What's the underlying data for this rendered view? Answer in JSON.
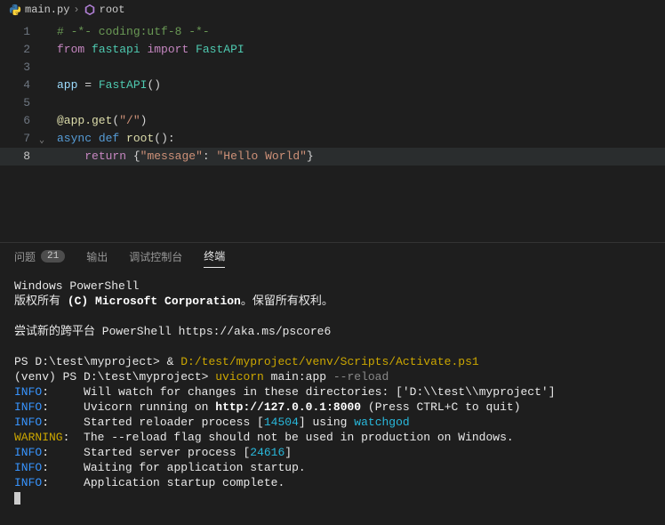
{
  "breadcrumb": {
    "file": "main.py",
    "symbol": "root"
  },
  "editor": {
    "lines": [
      {
        "n": 1,
        "html": "<span class='c-comment'># -*- coding:utf-8 -*-</span>"
      },
      {
        "n": 2,
        "html": "<span class='c-keyword'>from</span> <span class='c-module'>fastapi</span> <span class='c-keyword'>import</span> <span class='c-class'>FastAPI</span>"
      },
      {
        "n": 3,
        "html": ""
      },
      {
        "n": 4,
        "html": "<span class='c-var'>app</span> <span class='c-punc'>=</span> <span class='c-class'>FastAPI</span><span class='c-punc'>()</span>"
      },
      {
        "n": 5,
        "html": ""
      },
      {
        "n": 6,
        "html": "<span class='c-decor'>@app.get</span><span class='c-punc'>(</span><span class='c-str'>\"/\"</span><span class='c-punc'>)</span>"
      },
      {
        "n": 7,
        "html": "<span class='c-keyword2'>async</span> <span class='c-keyword2'>def</span> <span class='c-func'>root</span><span class='c-punc'>():</span>",
        "fold": true
      },
      {
        "n": 8,
        "html": "    <span class='c-keyword'>return</span> <span class='c-punc'>{</span><span class='c-str'>\"message\"</span><span class='c-punc'>:</span> <span class='c-str'>\"Hello World\"</span><span class='c-punc'>}</span>",
        "current": true,
        "hl": true
      }
    ]
  },
  "panel": {
    "tabs": {
      "problems": "问题",
      "problems_count": "21",
      "output": "输出",
      "debug": "调试控制台",
      "terminal": "终端"
    }
  },
  "terminal": {
    "l01": "Windows PowerShell",
    "l02a": "版权所有 ",
    "l02b": "(C) Microsoft Corporation",
    "l02c": "。保留所有权利。",
    "l04a": "尝试新的跨平台 PowerShell https://aka.ms/pscore6",
    "l06a": "PS D:\\test\\myproject> & ",
    "l06b": "D:/test/myproject/venv/Scripts/Activate.ps1",
    "l07a": "(venv) PS D:\\test\\myproject> ",
    "l07b": "uvicorn",
    "l07c": " main:app ",
    "l07d": "--reload",
    "l08a": "INFO",
    "l08b": ":     Will watch for changes in these directories: ['D:\\\\test\\\\myproject']",
    "l09a": "INFO",
    "l09b": ":     Uvicorn running on ",
    "l09c": "http://127.0.0.1:8000",
    "l09d": " (Press CTRL+C to quit)",
    "l10a": "INFO",
    "l10b": ":     Started reloader process [",
    "l10c": "14504",
    "l10d": "] using ",
    "l10e": "watchgod",
    "l11a": "WARNING",
    "l11b": ":  The --reload flag should not be used in production on Windows.",
    "l12a": "INFO",
    "l12b": ":     Started server process [",
    "l12c": "24616",
    "l12d": "]",
    "l13a": "INFO",
    "l13b": ":     Waiting for application startup.",
    "l14a": "INFO",
    "l14b": ":     Application startup complete."
  }
}
